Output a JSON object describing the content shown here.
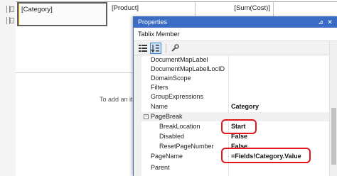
{
  "designer": {
    "cells": {
      "category": "[Category]",
      "product": "[Product]",
      "sum_cost": "[Sum(Cost)]"
    },
    "placeholder_fragment": "To add an ite"
  },
  "properties": {
    "title": "Properties",
    "close_glyph": "✕",
    "pin_glyph": "⊿",
    "object_name": "Tablix Member",
    "rows": [
      {
        "name": "DocumentMapLabel",
        "value": ""
      },
      {
        "name": "DocumentMapLabelLocID",
        "value": ""
      },
      {
        "name": "DomainScope",
        "value": ""
      },
      {
        "name": "Filters",
        "value": ""
      },
      {
        "name": "GroupExpressions",
        "value": ""
      },
      {
        "name": "Name",
        "value": "Category"
      },
      {
        "name": "PageBreak",
        "value": "",
        "section": true,
        "expander": "⊟"
      },
      {
        "name": "BreakLocation",
        "value": "Start",
        "indent": true
      },
      {
        "name": "Disabled",
        "value": "False",
        "indent": true
      },
      {
        "name": "ResetPageNumber",
        "value": "False",
        "indent": true
      },
      {
        "name": "PageName",
        "value": "=Fields!Category.Value"
      },
      {
        "name": "Parent",
        "value": ""
      }
    ]
  },
  "colors": {
    "titlebar": "#3b6cc4",
    "highlight": "#e3161d",
    "selection_accent": "#e0a400"
  },
  "icons": [
    "categorized-icon",
    "alphabetical-icon",
    "property-pages-icon",
    "pin-icon",
    "close-icon"
  ]
}
